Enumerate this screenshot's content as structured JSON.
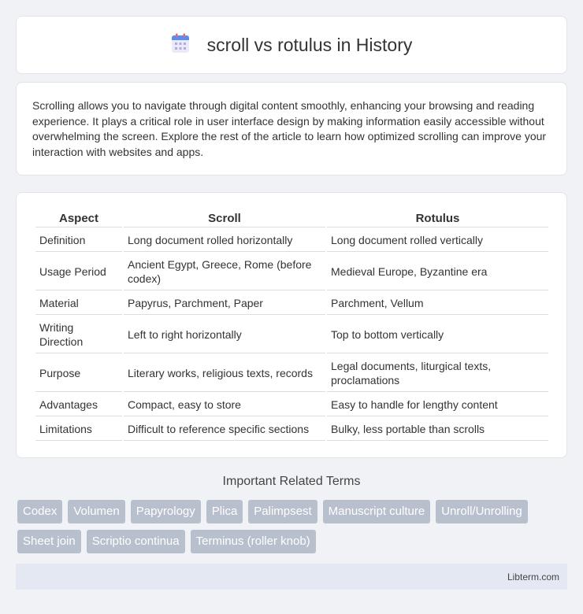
{
  "header": {
    "title": "scroll vs rotulus in History",
    "icon": "calendar-icon"
  },
  "intro": {
    "text": "Scrolling allows you to navigate through digital content smoothly, enhancing your browsing and reading experience. It plays a critical role in user interface design by making information easily accessible without overwhelming the screen. Explore the rest of the article to learn how optimized scrolling can improve your interaction with websites and apps."
  },
  "table": {
    "headers": [
      "Aspect",
      "Scroll",
      "Rotulus"
    ],
    "rows": [
      [
        "Definition",
        "Long document rolled horizontally",
        "Long document rolled vertically"
      ],
      [
        "Usage Period",
        "Ancient Egypt, Greece, Rome (before codex)",
        "Medieval Europe, Byzantine era"
      ],
      [
        "Material",
        "Papyrus, Parchment, Paper",
        "Parchment, Vellum"
      ],
      [
        "Writing Direction",
        "Left to right horizontally",
        "Top to bottom vertically"
      ],
      [
        "Purpose",
        "Literary works, religious texts, records",
        "Legal documents, liturgical texts, proclamations"
      ],
      [
        "Advantages",
        "Compact, easy to store",
        "Easy to handle for lengthy content"
      ],
      [
        "Limitations",
        "Difficult to reference specific sections",
        "Bulky, less portable than scrolls"
      ]
    ]
  },
  "related": {
    "title": "Important Related Terms",
    "tags": [
      "Codex",
      "Volumen",
      "Papyrology",
      "Plica",
      "Palimpsest",
      "Manuscript culture",
      "Unroll/Unrolling",
      "Sheet join",
      "Scriptio continua",
      "Terminus (roller knob)"
    ]
  },
  "footer": {
    "site": "Libterm.com"
  },
  "colors": {
    "background": "#f0f2f6",
    "tag_bg": "#b8bfcd",
    "footer_bg": "#e4e8f2"
  }
}
